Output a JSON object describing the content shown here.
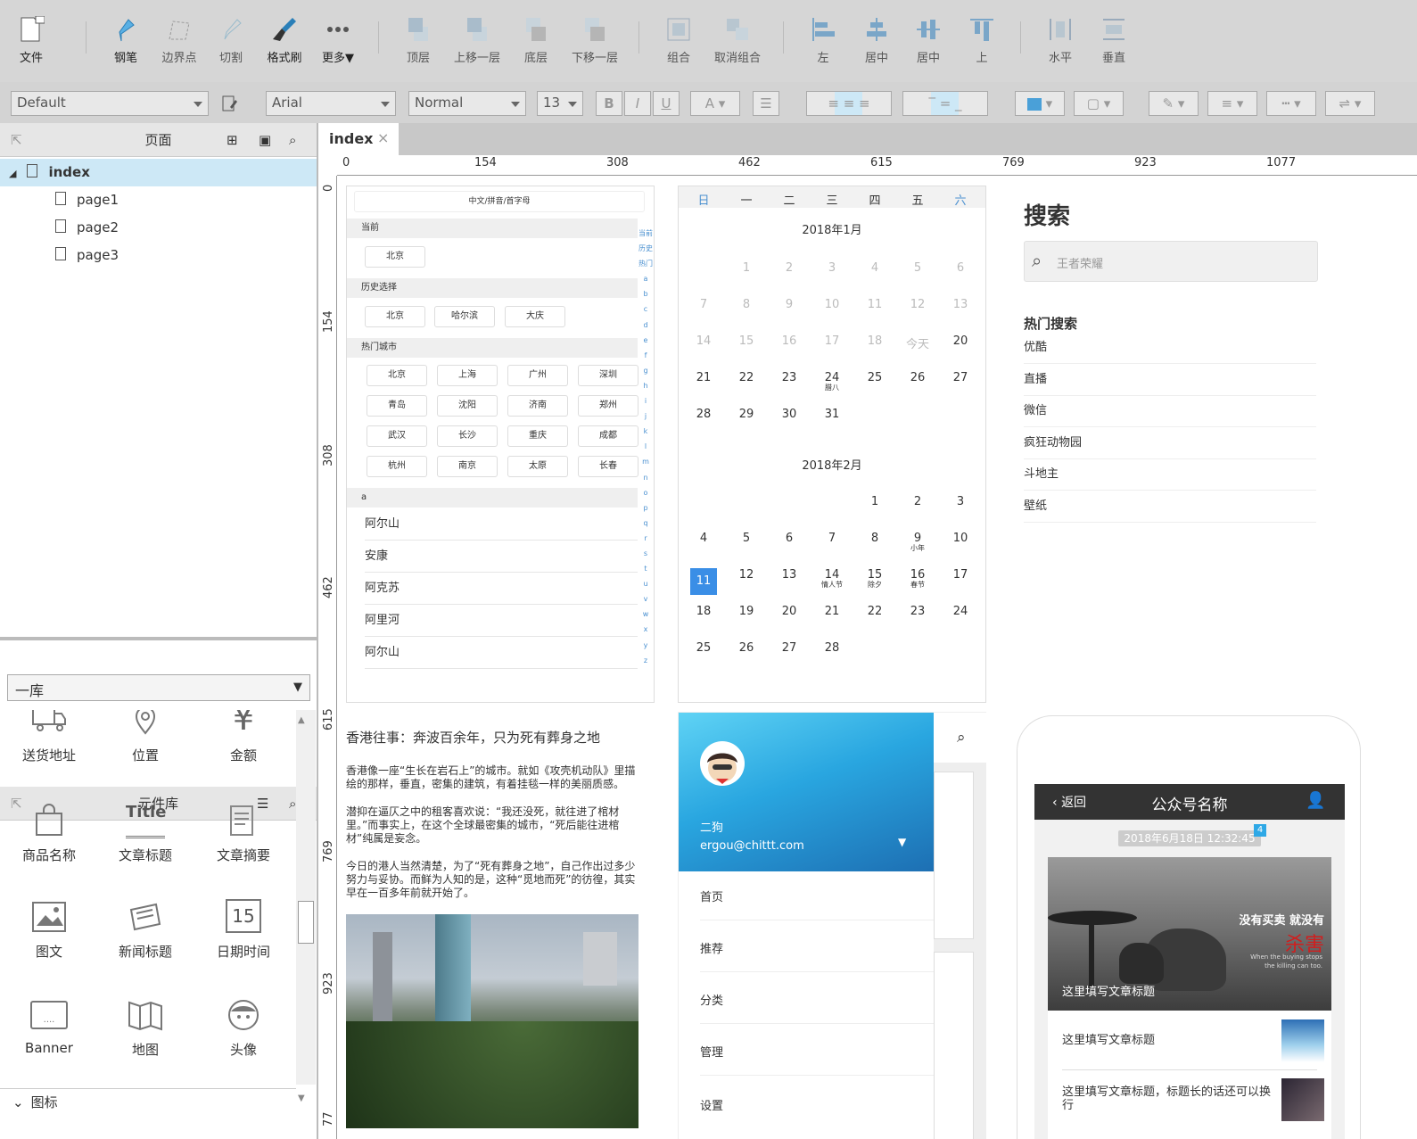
{
  "toolbar": {
    "file": "文件",
    "pen": "钢笔",
    "boundary": "边界点",
    "cut": "切割",
    "format_brush": "格式刷",
    "more": "更多▼",
    "top": "顶层",
    "up": "上移一层",
    "bottom": "底层",
    "down": "下移一层",
    "group": "组合",
    "ungroup": "取消组合",
    "left": "左",
    "hcenter": "居中",
    "vcenter": "居中",
    "up_align": "上",
    "horizontal": "水平",
    "vertical": "垂直"
  },
  "format": {
    "style": "Default",
    "font": "Arial",
    "weight": "Normal",
    "size": "13",
    "bold": "B",
    "italic": "I",
    "underline": "U",
    "color": "A"
  },
  "pages_panel": {
    "title": "页面",
    "root": "index",
    "pages": [
      "page1",
      "page2",
      "page3"
    ]
  },
  "library_panel": {
    "title": "元件库",
    "selected": "一库",
    "items": [
      "送货地址",
      "位置",
      "金额",
      "商品名称",
      "文章标题",
      "文章摘要",
      "图文",
      "新闻标题",
      "日期时间",
      "Banner",
      "地图",
      "头像"
    ],
    "title_icon_text": "Title",
    "date_icon_text": "15",
    "footer": "图标"
  },
  "tab": {
    "name": "index",
    "close": "×"
  },
  "ruler": {
    "h": [
      "0",
      "154",
      "308",
      "462",
      "615",
      "769",
      "923",
      "1077"
    ],
    "v": [
      "0",
      "154",
      "308",
      "462",
      "615",
      "769",
      "923",
      "77"
    ]
  },
  "city": {
    "search_placeholder": "中文/拼音/首字母",
    "current_label": "当前",
    "current": "北京",
    "history_label": "历史选择",
    "history": [
      "北京",
      "哈尔滨",
      "大庆"
    ],
    "hot_label": "热门城市",
    "hot": [
      "北京",
      "上海",
      "广州",
      "深圳",
      "青岛",
      "沈阳",
      "济南",
      "郑州",
      "武汉",
      "长沙",
      "重庆",
      "成都",
      "杭州",
      "南京",
      "太原",
      "长春"
    ],
    "letter_label": "a",
    "list": [
      "阿尔山",
      "安康",
      "阿克苏",
      "阿里河",
      "阿尔山"
    ],
    "index": [
      "当前",
      "历史",
      "热门",
      "a",
      "b",
      "c",
      "d",
      "e",
      "f",
      "g",
      "h",
      "i",
      "j",
      "k",
      "l",
      "m",
      "n",
      "o",
      "p",
      "q",
      "r",
      "s",
      "t",
      "u",
      "v",
      "w",
      "x",
      "y",
      "z"
    ]
  },
  "calendar": {
    "weekdays": [
      "日",
      "一",
      "二",
      "三",
      "四",
      "五",
      "六"
    ],
    "month1": "2018年1月",
    "month2": "2018年2月",
    "today": "今天",
    "jan_sub24": "腊八",
    "feb_sub9": "小年",
    "feb_sub14": "情人节",
    "feb_sub15": "除夕",
    "feb_sub16": "春节"
  },
  "search": {
    "title": "搜索",
    "placeholder": "王者荣耀",
    "hot_label": "热门搜索",
    "items": [
      "优酷",
      "直播",
      "微信",
      "疯狂动物园",
      "斗地主",
      "壁纸"
    ]
  },
  "article": {
    "title": "香港往事：奔波百余年，只为死有葬身之地",
    "p1": "香港像一座“生长在岩石上”的城市。就如《攻壳机动队》里描绘的那样，垂直，密集的建筑，有着挂毯一样的美丽质感。",
    "p2": "潜抑在逼仄之中的租客喜欢说：“我还没死，就往进了棺材里。”而事实上，在这个全球最密集的城市，“死后能往进棺材”纯属是妄念。",
    "p3": "今日的港人当然清楚，为了“死有葬身之地”，自己作出过多少努力与妥协。而鲜为人知的是，这种“觅地而死”的彷徨，其实早在一百多年前就开始了。"
  },
  "drawer": {
    "name": "二狗",
    "email": "ergou@chittt.com",
    "nav": [
      "首页",
      "推荐",
      "分类",
      "管理",
      "设置"
    ]
  },
  "wechat": {
    "back": "返回",
    "title": "公众号名称",
    "time": "2018年6月18日 12:32:45",
    "badge": "4",
    "cover_caption": "这里填写文章标题",
    "cover_slogan1": "没有买卖 就没有",
    "cover_slogan2": "杀害",
    "cover_small1": "When the buying stops",
    "cover_small2": "the killing can too.",
    "item1": "这里填写文章标题",
    "item2": "这里填写文章标题，标题长的话还可以换行"
  },
  "colors": {
    "accent": "#2ea8e6",
    "selected_row": "#cde8f6",
    "toolbar": "#d6d6d6"
  }
}
